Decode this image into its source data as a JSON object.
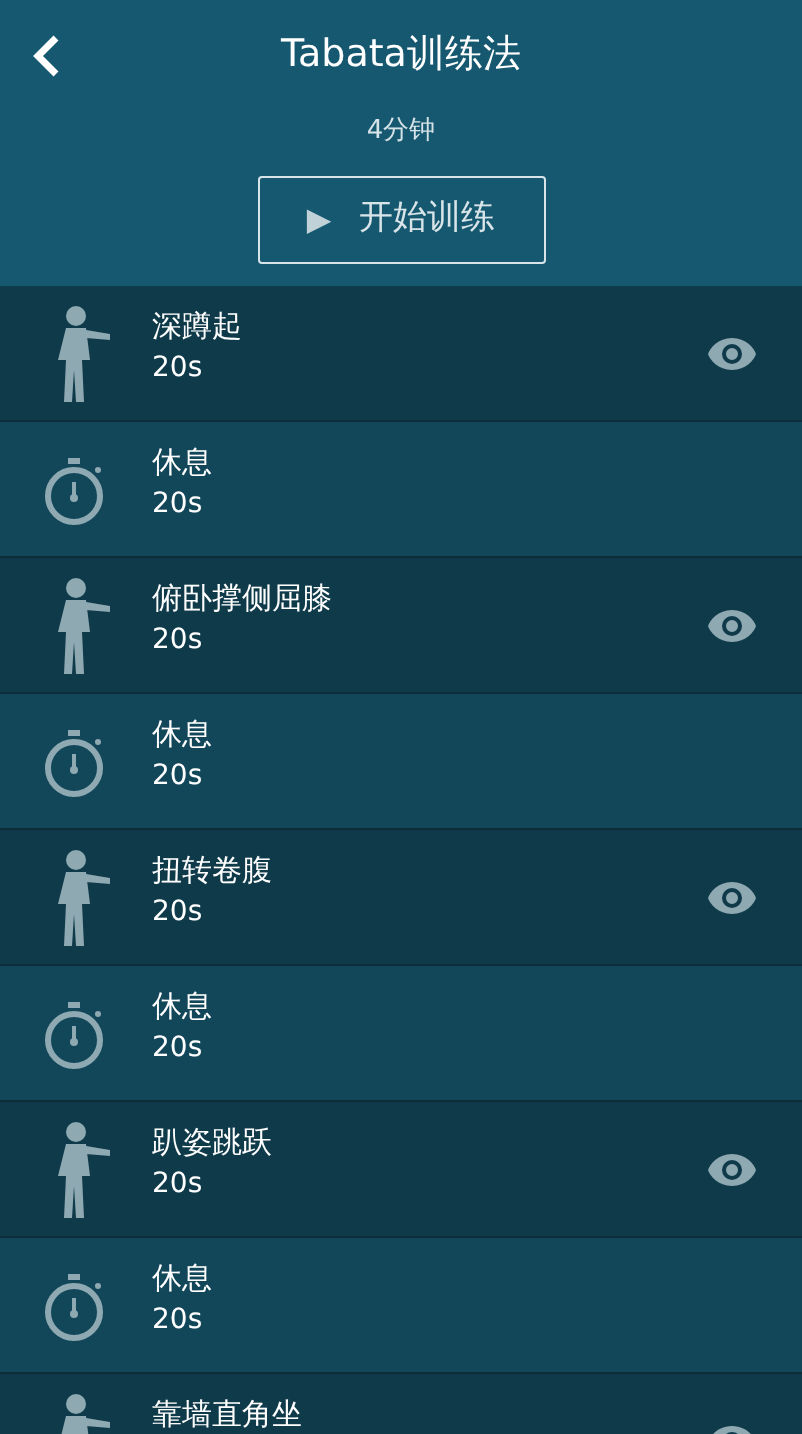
{
  "header": {
    "title": "Tabata训练法",
    "duration": "4分钟",
    "start_button": {
      "icon": "▶",
      "label": "开始训练"
    }
  },
  "items": [
    {
      "kind": "exercise",
      "name": "深蹲起",
      "duration": "20s"
    },
    {
      "kind": "rest",
      "name": "休息",
      "duration": "20s"
    },
    {
      "kind": "exercise",
      "name": "俯卧撑侧屈膝",
      "duration": "20s"
    },
    {
      "kind": "rest",
      "name": "休息",
      "duration": "20s"
    },
    {
      "kind": "exercise",
      "name": "扭转卷腹",
      "duration": "20s"
    },
    {
      "kind": "rest",
      "name": "休息",
      "duration": "20s"
    },
    {
      "kind": "exercise",
      "name": "趴姿跳跃",
      "duration": "20s"
    },
    {
      "kind": "rest",
      "name": "休息",
      "duration": "20s"
    },
    {
      "kind": "exercise",
      "name": "靠墙直角坐"
    }
  ]
}
